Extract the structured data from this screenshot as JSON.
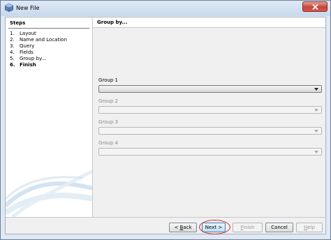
{
  "window": {
    "title": "New File"
  },
  "steps": {
    "heading": "Steps",
    "items": [
      {
        "num": "1.",
        "label": "Layout"
      },
      {
        "num": "2.",
        "label": "Name and Location"
      },
      {
        "num": "3.",
        "label": "Query"
      },
      {
        "num": "4.",
        "label": "Fields"
      },
      {
        "num": "5.",
        "label": "Group by..."
      },
      {
        "num": "6.",
        "label": "Finish"
      }
    ],
    "current_index": 5
  },
  "panel": {
    "title": "Group by..."
  },
  "groups": [
    {
      "label": "Group 1",
      "value": "",
      "enabled": true
    },
    {
      "label": "Group 2",
      "value": "",
      "enabled": false
    },
    {
      "label": "Group 3",
      "value": "",
      "enabled": false
    },
    {
      "label": "Group 4",
      "value": "",
      "enabled": false
    }
  ],
  "buttons": {
    "back": {
      "mnemonic": "B",
      "rest": "ack",
      "prefix": "< "
    },
    "next": {
      "label": "Next >"
    },
    "finish": {
      "mnemonic": "F",
      "rest": "inish"
    },
    "cancel": {
      "label": "Cancel"
    },
    "help": {
      "mnemonic": "H",
      "rest": "elp"
    }
  },
  "colors": {
    "highlight_ring": "#d02a2a",
    "close_button": "#c6453a"
  }
}
